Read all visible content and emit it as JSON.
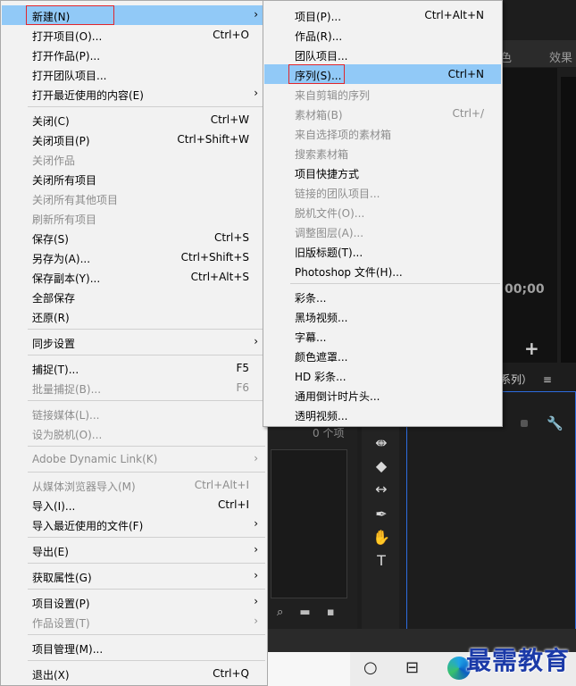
{
  "background": {
    "panel_tab_partial": "色",
    "panel_tab_effects": "效果",
    "timecode": "00;00",
    "add_label": "+",
    "sequence_tab": "系列）",
    "sequence_menu_glyph": "≡",
    "project_item_count": "0 个项",
    "watermark": "最需教育"
  },
  "main_menu": [
    {
      "label": "新建(N)",
      "shortcut": "",
      "arrow": true,
      "disabled": false,
      "highlight": true
    },
    {
      "label": "打开项目(O)...",
      "shortcut": "Ctrl+O",
      "arrow": false,
      "disabled": false
    },
    {
      "label": "打开作品(P)...",
      "shortcut": "",
      "arrow": false,
      "disabled": false
    },
    {
      "label": "打开团队项目...",
      "shortcut": "",
      "arrow": false,
      "disabled": false
    },
    {
      "label": "打开最近使用的内容(E)",
      "shortcut": "",
      "arrow": true,
      "disabled": false
    },
    {
      "label": "关闭(C)",
      "shortcut": "Ctrl+W",
      "arrow": false,
      "disabled": false
    },
    {
      "label": "关闭项目(P)",
      "shortcut": "Ctrl+Shift+W",
      "arrow": false,
      "disabled": false
    },
    {
      "label": "关闭作品",
      "shortcut": "",
      "arrow": false,
      "disabled": true
    },
    {
      "label": "关闭所有项目",
      "shortcut": "",
      "arrow": false,
      "disabled": false
    },
    {
      "label": "关闭所有其他项目",
      "shortcut": "",
      "arrow": false,
      "disabled": true
    },
    {
      "label": "刷新所有项目",
      "shortcut": "",
      "arrow": false,
      "disabled": true
    },
    {
      "label": "保存(S)",
      "shortcut": "Ctrl+S",
      "arrow": false,
      "disabled": false
    },
    {
      "label": "另存为(A)...",
      "shortcut": "Ctrl+Shift+S",
      "arrow": false,
      "disabled": false
    },
    {
      "label": "保存副本(Y)...",
      "shortcut": "Ctrl+Alt+S",
      "arrow": false,
      "disabled": false
    },
    {
      "label": "全部保存",
      "shortcut": "",
      "arrow": false,
      "disabled": false
    },
    {
      "label": "还原(R)",
      "shortcut": "",
      "arrow": false,
      "disabled": false
    },
    {
      "label": "同步设置",
      "shortcut": "",
      "arrow": true,
      "disabled": false
    },
    {
      "label": "捕捉(T)...",
      "shortcut": "F5",
      "arrow": false,
      "disabled": false
    },
    {
      "label": "批量捕捉(B)...",
      "shortcut": "F6",
      "arrow": false,
      "disabled": true
    },
    {
      "label": "链接媒体(L)...",
      "shortcut": "",
      "arrow": false,
      "disabled": true
    },
    {
      "label": "设为脱机(O)...",
      "shortcut": "",
      "arrow": false,
      "disabled": true
    },
    {
      "label": "Adobe Dynamic Link(K)",
      "shortcut": "",
      "arrow": true,
      "disabled": true
    },
    {
      "label": "从媒体浏览器导入(M)",
      "shortcut": "Ctrl+Alt+I",
      "arrow": false,
      "disabled": true
    },
    {
      "label": "导入(I)...",
      "shortcut": "Ctrl+I",
      "arrow": false,
      "disabled": false
    },
    {
      "label": "导入最近使用的文件(F)",
      "shortcut": "",
      "arrow": true,
      "disabled": false
    },
    {
      "label": "导出(E)",
      "shortcut": "",
      "arrow": true,
      "disabled": false
    },
    {
      "label": "获取属性(G)",
      "shortcut": "",
      "arrow": true,
      "disabled": false
    },
    {
      "label": "项目设置(P)",
      "shortcut": "",
      "arrow": true,
      "disabled": false
    },
    {
      "label": "作品设置(T)",
      "shortcut": "",
      "arrow": true,
      "disabled": true
    },
    {
      "label": "项目管理(M)...",
      "shortcut": "",
      "arrow": false,
      "disabled": false
    },
    {
      "label": "退出(X)",
      "shortcut": "Ctrl+Q",
      "arrow": false,
      "disabled": false
    }
  ],
  "sub_menu": [
    {
      "label": "项目(P)...",
      "shortcut": "Ctrl+Alt+N",
      "disabled": false
    },
    {
      "label": "作品(R)...",
      "shortcut": "",
      "disabled": false
    },
    {
      "label": "团队项目...",
      "shortcut": "",
      "disabled": false
    },
    {
      "label": "序列(S)...",
      "shortcut": "Ctrl+N",
      "disabled": false,
      "highlight": true
    },
    {
      "label": "来自剪辑的序列",
      "shortcut": "",
      "disabled": true
    },
    {
      "label": "素材箱(B)",
      "shortcut": "Ctrl+/",
      "disabled": true
    },
    {
      "label": "来自选择项的素材箱",
      "shortcut": "",
      "disabled": true
    },
    {
      "label": "搜索素材箱",
      "shortcut": "",
      "disabled": true
    },
    {
      "label": "项目快捷方式",
      "shortcut": "",
      "disabled": false
    },
    {
      "label": "链接的团队项目...",
      "shortcut": "",
      "disabled": true
    },
    {
      "label": "脱机文件(O)...",
      "shortcut": "",
      "disabled": true
    },
    {
      "label": "调整图层(A)...",
      "shortcut": "",
      "disabled": true
    },
    {
      "label": "旧版标题(T)...",
      "shortcut": "",
      "disabled": false
    },
    {
      "label": "Photoshop 文件(H)...",
      "shortcut": "",
      "disabled": false
    },
    {
      "label": "彩条...",
      "shortcut": "",
      "disabled": false
    },
    {
      "label": "黑场视频...",
      "shortcut": "",
      "disabled": false
    },
    {
      "label": "字幕...",
      "shortcut": "",
      "disabled": false
    },
    {
      "label": "颜色遮罩...",
      "shortcut": "",
      "disabled": false
    },
    {
      "label": "HD 彩条...",
      "shortcut": "",
      "disabled": false
    },
    {
      "label": "通用倒计时片头...",
      "shortcut": "",
      "disabled": false
    },
    {
      "label": "透明视频...",
      "shortcut": "",
      "disabled": false
    }
  ],
  "colors": {
    "highlight": "#91c9f7",
    "annotation_box": "#e0262d",
    "accent_blue": "#2d6cdf"
  }
}
